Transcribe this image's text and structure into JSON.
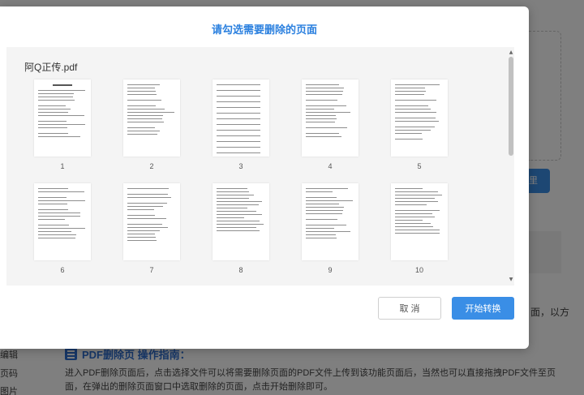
{
  "background": {
    "button_fragment": "里",
    "tail_text": "面，以方",
    "sidebar_items": [
      "编辑",
      "页码",
      "图片"
    ],
    "guide_title": "PDF删除页 操作指南：",
    "guide_body": "进入PDF删除页面后，点击选择文件可以将需要删除页面的PDF文件上传到该功能页面后，当然也可以直接拖拽PDF文件至页面，在弹出的删除页面窗口中选取删除的页面，点击开始删除即可。"
  },
  "dialog": {
    "title": "请勾选需要删除的页面",
    "file_name": "阿Q正传.pdf",
    "pages": [
      "1",
      "2",
      "3",
      "4",
      "5",
      "6",
      "7",
      "8",
      "9",
      "10"
    ],
    "cancel_label": "取 消",
    "start_label": "开始转换"
  },
  "colors": {
    "accent": "#3a8ee6",
    "title_blue": "#2b80df",
    "overlay": "rgba(0,0,0,0.5)"
  }
}
